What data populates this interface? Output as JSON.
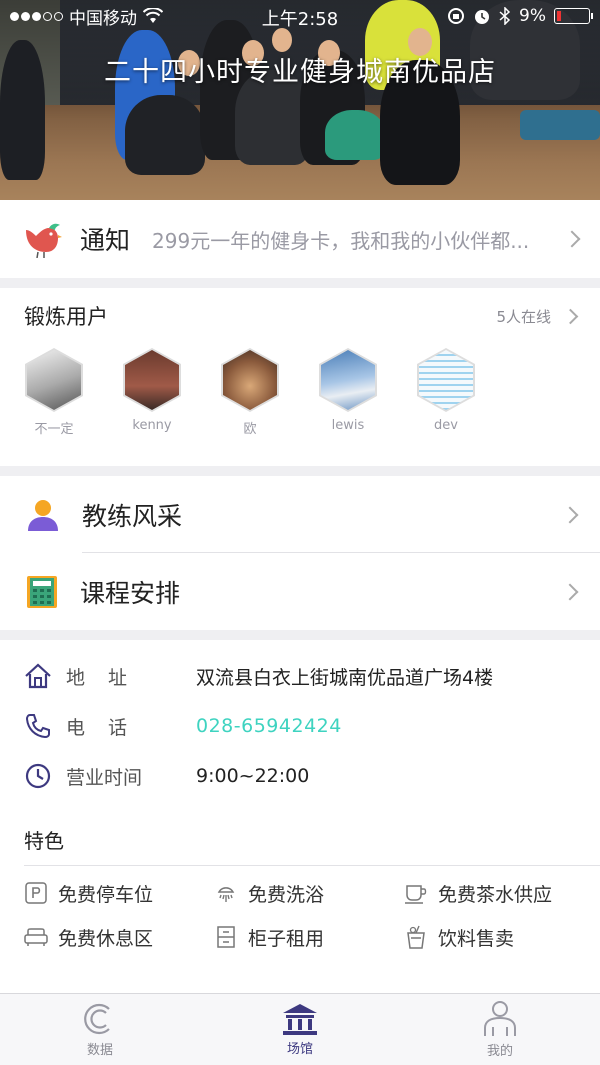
{
  "status_bar": {
    "carrier": "中国移动",
    "time": "上午2:58",
    "battery": "9%"
  },
  "hero": {
    "title": "二十四小时专业健身城南优品店"
  },
  "notice": {
    "label": "通知",
    "text": "299元一年的健身卡，我和我的小伙伴都..."
  },
  "users": {
    "title": "锻炼用户",
    "online": "5人在线",
    "avatars": [
      {
        "name": "不一定",
        "color": "#bdbdbd"
      },
      {
        "name": "kenny",
        "color": "#8a4b3c"
      },
      {
        "name": "欧",
        "color": "#9b6a4c"
      },
      {
        "name": "lewis",
        "color": "#7fa9d6"
      },
      {
        "name": "dev",
        "color": "#cfe6f5"
      }
    ]
  },
  "menu": {
    "coach": "教练风采",
    "schedule": "课程安排"
  },
  "info": {
    "address_key": "地　址",
    "address": "双流县白衣上街城南优品道广场4楼",
    "phone_key": "电　话",
    "phone": "028-65942424",
    "hours_key": "营业时间",
    "hours": "9:00~22:00"
  },
  "features": {
    "title": "特色",
    "items": [
      {
        "label": "免费停车位",
        "icon": "parking-icon"
      },
      {
        "label": "免费洗浴",
        "icon": "shower-icon"
      },
      {
        "label": "免费茶水供应",
        "icon": "tea-cup-icon"
      },
      {
        "label": "免费休息区",
        "icon": "sofa-icon"
      },
      {
        "label": "柜子租用",
        "icon": "locker-icon"
      },
      {
        "label": "饮料售卖",
        "icon": "drink-icon"
      }
    ]
  },
  "tabs": [
    {
      "label": "数据",
      "icon": "data-icon"
    },
    {
      "label": "场馆",
      "icon": "venue-icon",
      "active": true
    },
    {
      "label": "我的",
      "icon": "profile-icon"
    }
  ],
  "colors": {
    "accent": "#3d3980",
    "phone": "#3ed3c0",
    "notice_bird": "#e0564f"
  }
}
